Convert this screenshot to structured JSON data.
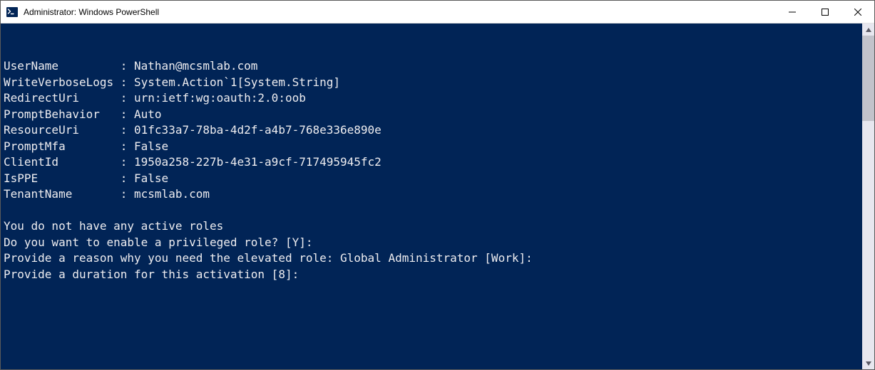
{
  "window": {
    "title": "Administrator: Windows PowerShell"
  },
  "output": {
    "kv": [
      {
        "key": "UserName",
        "value": "Nathan@mcsmlab.com"
      },
      {
        "key": "WriteVerboseLogs",
        "value": "System.Action`1[System.String]"
      },
      {
        "key": "RedirectUri",
        "value": "urn:ietf:wg:oauth:2.0:oob"
      },
      {
        "key": "PromptBehavior",
        "value": "Auto"
      },
      {
        "key": "ResourceUri",
        "value": "01fc33a7-78ba-4d2f-a4b7-768e336e890e"
      },
      {
        "key": "PromptMfa",
        "value": "False"
      },
      {
        "key": "ClientId",
        "value": "1950a258-227b-4e31-a9cf-717495945fc2"
      },
      {
        "key": "IsPPE",
        "value": "False"
      },
      {
        "key": "TenantName",
        "value": "mcsmlab.com"
      }
    ],
    "lines": [
      "You do not have any active roles",
      "Do you want to enable a privileged role? [Y]:",
      "Provide a reason why you need the elevated role: Global Administrator [Work]:",
      "Provide a duration for this activation [8]:"
    ]
  }
}
